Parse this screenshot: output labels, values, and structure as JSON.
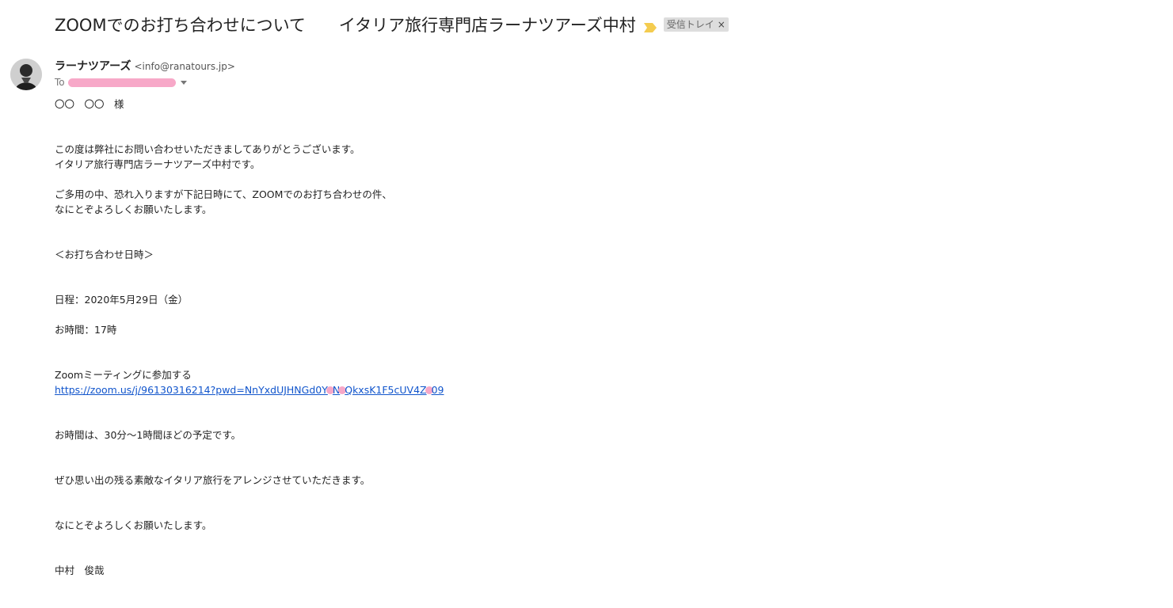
{
  "email": {
    "subject": "ZOOMでのお打ち合わせについて　　イタリア旅行専門店ラーナツアーズ中村",
    "label": "受信トレイ",
    "label_close": "×",
    "colors": {
      "importance": "#f4cc4f",
      "link": "#1155cc",
      "redaction": "#f7a8c8",
      "chip_bg": "#dddddd"
    },
    "sender": {
      "name": "ラーナツアーズ",
      "email": "<info@ranatours.jp>",
      "to_label": "To"
    },
    "body": {
      "greeting": "〇〇　〇〇　様",
      "p1_line1": "この度は弊社にお問い合わせいただきましてありがとうございます。",
      "p1_line2": "イタリア旅行専門店ラーナツアーズ中村です。",
      "p2_line1": "ご多用の中、恐れ入りますが下記日時にて、ZOOMでのお打ち合わせの件、",
      "p2_line2": "なにとぞよろしくお願いたします。",
      "meeting_heading": "＜お打ち合わせ日時＞",
      "date_line": "日程：2020年5月29日（金）",
      "time_line": "お時間：17時",
      "zoom_label": "Zoomミーティングに参加する",
      "zoom_link_part1": "https://zoom.us/j/96130316214?pwd=NnYxdUJHNGd0Y",
      "zoom_link_part2": "N",
      "zoom_link_part3": "QkxsK1F5cUV4Z",
      "zoom_link_part4": "09",
      "duration_line": "お時間は、30分～1時間ほどの予定です。",
      "closing_line": "ぜひ思い出の残る素敵なイタリア旅行をアレンジさせていただきます。",
      "regards_line": "なにとぞよろしくお願いたします。",
      "signature": "中村　俊哉"
    }
  }
}
